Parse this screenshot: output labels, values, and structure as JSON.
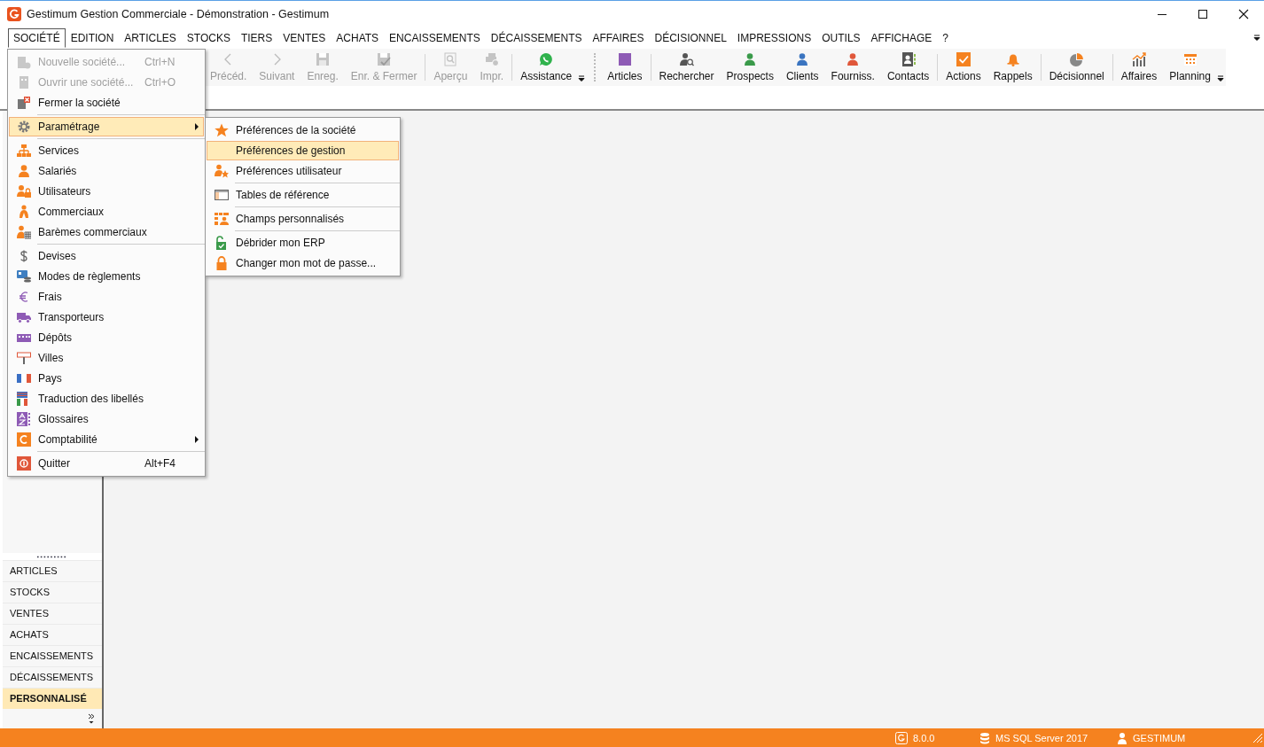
{
  "window": {
    "title": "Gestimum Gestion Commerciale - Démonstration - Gestimum"
  },
  "menu_bar": [
    {
      "label": "SOCIÉTÉ",
      "selected": true
    },
    {
      "label": "EDITION",
      "selected": false
    },
    {
      "label": "ARTICLES",
      "selected": false
    },
    {
      "label": "STOCKS",
      "selected": false
    },
    {
      "label": "TIERS",
      "selected": false
    },
    {
      "label": "VENTES",
      "selected": false
    },
    {
      "label": "ACHATS",
      "selected": false
    },
    {
      "label": "ENCAISSEMENTS",
      "selected": false
    },
    {
      "label": "DÉCAISSEMENTS",
      "selected": false
    },
    {
      "label": "AFFAIRES",
      "selected": false
    },
    {
      "label": "DÉCISIONNEL",
      "selected": false
    },
    {
      "label": "IMPRESSIONS",
      "selected": false
    },
    {
      "label": "OUTILS",
      "selected": false
    },
    {
      "label": "AFFICHAGE",
      "selected": false
    },
    {
      "label": "?",
      "selected": false
    }
  ],
  "toolbar": [
    {
      "kind": "button",
      "label": "Précéd.",
      "disabled": true
    },
    {
      "kind": "button",
      "label": "Suivant",
      "disabled": true
    },
    {
      "kind": "button",
      "label": "Enreg.",
      "disabled": true
    },
    {
      "kind": "button",
      "label": "Enr. & Fermer",
      "disabled": true
    },
    {
      "kind": "separator"
    },
    {
      "kind": "button",
      "label": "Aperçu",
      "disabled": true
    },
    {
      "kind": "button",
      "label": "Impr.",
      "disabled": true
    },
    {
      "kind": "separator"
    },
    {
      "kind": "button",
      "label": "Assistance",
      "disabled": false
    },
    {
      "kind": "overflow"
    },
    {
      "kind": "button",
      "label": "Articles",
      "disabled": false
    },
    {
      "kind": "separator"
    },
    {
      "kind": "button",
      "label": "Rechercher",
      "disabled": false
    },
    {
      "kind": "button",
      "label": "Prospects",
      "disabled": false
    },
    {
      "kind": "button",
      "label": "Clients",
      "disabled": false
    },
    {
      "kind": "button",
      "label": "Fourniss.",
      "disabled": false
    },
    {
      "kind": "button",
      "label": "Contacts",
      "disabled": false
    },
    {
      "kind": "separator"
    },
    {
      "kind": "button",
      "label": "Actions",
      "disabled": false
    },
    {
      "kind": "button",
      "label": "Rappels",
      "disabled": false
    },
    {
      "kind": "separator"
    },
    {
      "kind": "button",
      "label": "Décisionnel",
      "disabled": false
    },
    {
      "kind": "separator"
    },
    {
      "kind": "button",
      "label": "Affaires",
      "disabled": false
    },
    {
      "kind": "button",
      "label": "Planning",
      "disabled": false
    },
    {
      "kind": "overflow"
    }
  ],
  "sidebar": {
    "items": [
      {
        "label": "ARTICLES",
        "selected": false
      },
      {
        "label": "STOCKS",
        "selected": false
      },
      {
        "label": "VENTES",
        "selected": false
      },
      {
        "label": "ACHATS",
        "selected": false
      },
      {
        "label": "ENCAISSEMENTS",
        "selected": false
      },
      {
        "label": "DÉCAISSEMENTS",
        "selected": false
      },
      {
        "label": "PERSONNALISÉ",
        "selected": true
      }
    ]
  },
  "dropdown_menu": {
    "items": [
      {
        "kind": "item",
        "label": "Nouvelle société...",
        "shortcut": "Ctrl+N",
        "disabled": true,
        "selected": false,
        "submenu": false
      },
      {
        "kind": "item",
        "label": "Ouvrir une société...",
        "shortcut": "Ctrl+O",
        "disabled": true,
        "selected": false,
        "submenu": false
      },
      {
        "kind": "item",
        "label": "Fermer la société",
        "disabled": false,
        "selected": false,
        "submenu": false
      },
      {
        "kind": "separator"
      },
      {
        "kind": "item",
        "label": "Paramétrage",
        "disabled": false,
        "selected": true,
        "submenu": true
      },
      {
        "kind": "separator"
      },
      {
        "kind": "item",
        "label": "Services",
        "disabled": false,
        "selected": false,
        "submenu": false
      },
      {
        "kind": "item",
        "label": "Salariés",
        "disabled": false,
        "selected": false,
        "submenu": false
      },
      {
        "kind": "item",
        "label": "Utilisateurs",
        "disabled": false,
        "selected": false,
        "submenu": false
      },
      {
        "kind": "item",
        "label": "Commerciaux",
        "disabled": false,
        "selected": false,
        "submenu": false
      },
      {
        "kind": "item",
        "label": "Barèmes commerciaux",
        "disabled": false,
        "selected": false,
        "submenu": false
      },
      {
        "kind": "separator"
      },
      {
        "kind": "item",
        "label": "Devises",
        "disabled": false,
        "selected": false,
        "submenu": false
      },
      {
        "kind": "item",
        "label": "Modes de règlements",
        "disabled": false,
        "selected": false,
        "submenu": false
      },
      {
        "kind": "item",
        "label": "Frais",
        "disabled": false,
        "selected": false,
        "submenu": false
      },
      {
        "kind": "item",
        "label": "Transporteurs",
        "disabled": false,
        "selected": false,
        "submenu": false
      },
      {
        "kind": "item",
        "label": "Dépôts",
        "disabled": false,
        "selected": false,
        "submenu": false
      },
      {
        "kind": "item",
        "label": "Villes",
        "disabled": false,
        "selected": false,
        "submenu": false
      },
      {
        "kind": "item",
        "label": "Pays",
        "disabled": false,
        "selected": false,
        "submenu": false
      },
      {
        "kind": "item",
        "label": "Traduction des libellés",
        "disabled": false,
        "selected": false,
        "submenu": false
      },
      {
        "kind": "item",
        "label": "Glossaires",
        "disabled": false,
        "selected": false,
        "submenu": false
      },
      {
        "kind": "item",
        "label": "Comptabilité",
        "disabled": false,
        "selected": false,
        "submenu": true
      },
      {
        "kind": "separator"
      },
      {
        "kind": "item",
        "label": "Quitter",
        "shortcut": "Alt+F4",
        "disabled": false,
        "selected": false,
        "submenu": false
      }
    ]
  },
  "submenu": {
    "items": [
      {
        "kind": "item",
        "label": "Préférences de la société",
        "selected": false
      },
      {
        "kind": "item",
        "label": "Préférences de gestion",
        "selected": true
      },
      {
        "kind": "item",
        "label": "Préférences utilisateur",
        "selected": false
      },
      {
        "kind": "separator"
      },
      {
        "kind": "item",
        "label": "Tables de référence",
        "selected": false
      },
      {
        "kind": "separator"
      },
      {
        "kind": "item",
        "label": "Champs personnalisés",
        "selected": false
      },
      {
        "kind": "separator"
      },
      {
        "kind": "item",
        "label": "Débrider mon ERP",
        "selected": false
      },
      {
        "kind": "item",
        "label": "Changer mon mot de passe...",
        "selected": false
      }
    ]
  },
  "status_bar": {
    "version": "8.0.0",
    "database": "MS SQL Server 2017",
    "user": "GESTIMUM"
  }
}
